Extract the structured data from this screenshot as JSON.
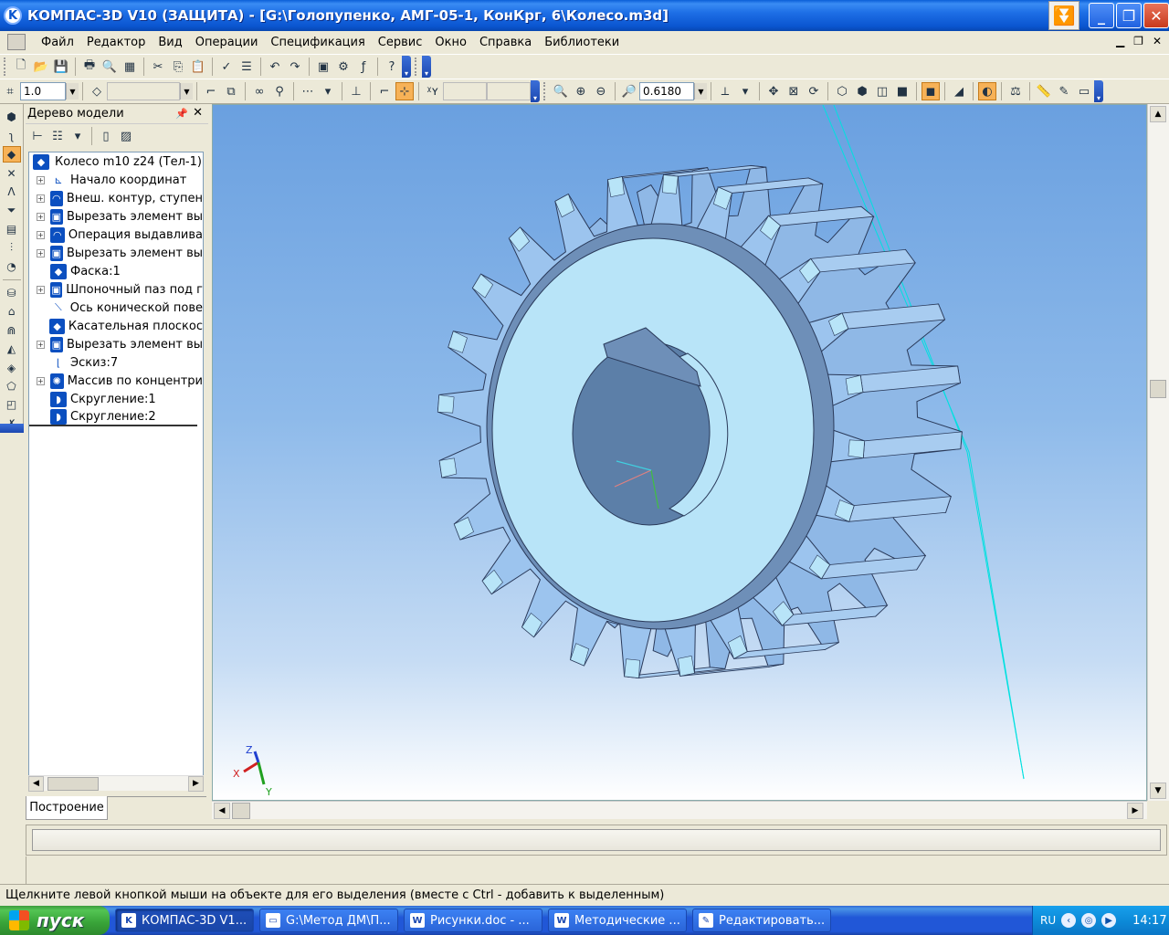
{
  "window": {
    "title": "КОМПАС-3D V10 (ЗАЩИТА) - [G:\\Голопупенко, АМГ-05-1, КонКрг, 6\\Колесо.m3d]",
    "app_icon_letter": "K"
  },
  "menu": {
    "items": [
      "Файл",
      "Редактор",
      "Вид",
      "Операции",
      "Спецификация",
      "Сервис",
      "Окно",
      "Справка",
      "Библиотеки"
    ]
  },
  "toolbar": {
    "scale_value": "1.0",
    "zoom_value": "0.6180"
  },
  "tree": {
    "header": "Дерево модели",
    "root": "Колесо m10 z24 (Тел-1)",
    "items": [
      {
        "label": "Начало координат",
        "expandable": true,
        "icon": "origin-icon"
      },
      {
        "label": "Внеш. контур, ступен",
        "expandable": true,
        "icon": "extrude-icon"
      },
      {
        "label": "Вырезать элемент вы",
        "expandable": true,
        "icon": "cut-icon"
      },
      {
        "label": "Операция выдавлива",
        "expandable": true,
        "icon": "extrude-icon"
      },
      {
        "label": "Вырезать элемент вы",
        "expandable": true,
        "icon": "cut-icon"
      },
      {
        "label": "Фаска:1",
        "expandable": false,
        "icon": "chamfer-icon"
      },
      {
        "label": "Шпоночный паз под г",
        "expandable": true,
        "icon": "keyway-icon"
      },
      {
        "label": "Ось конической пове",
        "expandable": false,
        "icon": "axis-icon"
      },
      {
        "label": "Касательная плоскос",
        "expandable": false,
        "icon": "plane-icon"
      },
      {
        "label": "Вырезать элемент вы",
        "expandable": true,
        "icon": "cut-icon"
      },
      {
        "label": "Эскиз:7",
        "expandable": false,
        "icon": "sketch-icon"
      },
      {
        "label": "Массив по концентри",
        "expandable": true,
        "icon": "pattern-icon"
      },
      {
        "label": "Скругление:1",
        "expandable": false,
        "icon": "fillet-icon"
      },
      {
        "label": "Скругление:2",
        "expandable": false,
        "icon": "fillet-icon"
      }
    ],
    "tab_label": "Построение"
  },
  "axes": {
    "x": "X",
    "y": "Y",
    "z": "Z"
  },
  "status": {
    "text": "Щелкните левой кнопкой мыши на объекте для его выделения (вместе с Ctrl - добавить к выделенным)"
  },
  "taskbar": {
    "start_label": "пуск",
    "items": [
      {
        "label": "КОМПАС-3D V1...",
        "active": true,
        "icon": "K"
      },
      {
        "label": "G:\\Метод ДМ\\П...",
        "active": false,
        "icon": "▭"
      },
      {
        "label": "Рисунки.doc - ...",
        "active": false,
        "icon": "W"
      },
      {
        "label": "Методические ...",
        "active": false,
        "icon": "W"
      },
      {
        "label": "Редактировать...",
        "active": false,
        "icon": "✎"
      }
    ],
    "lang": "RU",
    "clock": "14:17"
  },
  "colors": {
    "gear_top": "#B8E4F8",
    "gear_side": "#8FB8E6",
    "gear_dark": "#5C7FA8",
    "construction_line": "#00E0E0"
  }
}
